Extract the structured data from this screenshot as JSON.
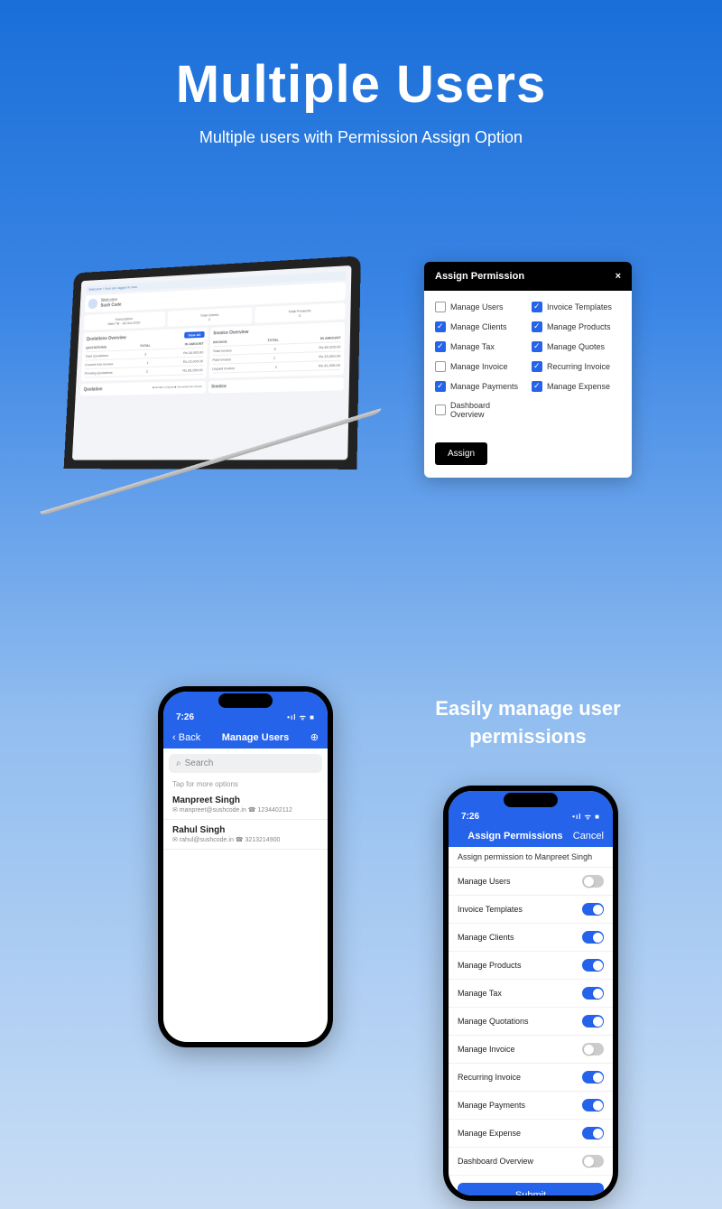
{
  "hero": {
    "title": "Multiple Users",
    "subtitle": "Multiple users with Permission Assign Option"
  },
  "subtitle2": "Easily manage user permissions",
  "laptop": {
    "banner": "Welcome ! Your are logged in now.",
    "welcome_label": "Welcome",
    "user": "Sush Code",
    "sub_label": "Subscription",
    "sub_value": "Valid Till - 18-Oct-2029",
    "clients_label": "Total Clients",
    "clients_value": "2",
    "products_label": "Total Products",
    "products_value": "3",
    "quotations_title": "Quotations Overview",
    "invoice_title": "Invoice Overview",
    "view_all": "View All",
    "q_headers": {
      "a": "QUOTATIONS",
      "b": "TOTAL",
      "c": "IN AMOUNT"
    },
    "i_headers": {
      "a": "INVOICE",
      "b": "TOTAL",
      "c": "IN AMOUNT"
    },
    "q_rows": [
      {
        "label": "Total Quotations",
        "total": "3",
        "amount": "Rs.18,005.00"
      },
      {
        "label": "Convert Into Invoice",
        "total": "1",
        "amount": "Rs.23,000.00"
      },
      {
        "label": "Pending Quotations",
        "total": "2",
        "amount": "Rs.65,255.00"
      }
    ],
    "i_rows": [
      {
        "label": "Total Invoice",
        "total": "3",
        "amount": "Rs.64,005.00"
      },
      {
        "label": "Paid Invoice",
        "total": "1",
        "amount": "Rs.23,000.00"
      },
      {
        "label": "Unpaid Invoice",
        "total": "2",
        "amount": "Rs.41,005.00"
      }
    ],
    "quotation_label": "Quotation",
    "invoice_label": "Invoice",
    "legend1": "Number of Quote",
    "legend2": "Converted into Invoice"
  },
  "perm_card": {
    "title": "Assign Permission",
    "left": [
      {
        "label": "Manage Users",
        "checked": false
      },
      {
        "label": "Manage Clients",
        "checked": true
      },
      {
        "label": "Manage Tax",
        "checked": true
      },
      {
        "label": "Manage Invoice",
        "checked": false
      },
      {
        "label": "Manage Payments",
        "checked": true
      },
      {
        "label": "Dashboard Overview",
        "checked": false
      }
    ],
    "right": [
      {
        "label": "Invoice Templates",
        "checked": true
      },
      {
        "label": "Manage Products",
        "checked": true
      },
      {
        "label": "Manage Quotes",
        "checked": true
      },
      {
        "label": "Recurring Invoice",
        "checked": true
      },
      {
        "label": "Manage Expense",
        "checked": true
      }
    ],
    "assign": "Assign"
  },
  "phone1": {
    "time": "7:26",
    "back": "Back",
    "title": "Manage Users",
    "search": "Search",
    "hint": "Tap for more options",
    "users": [
      {
        "name": "Manpreet Singh",
        "meta": "✉ manpreet@sushcode.in ☎ 1234402112"
      },
      {
        "name": "Rahul Singh",
        "meta": "✉ rahul@sushcode.in ☎ 3213214900"
      }
    ]
  },
  "phone2": {
    "time": "7:26",
    "title": "Assign Permissions",
    "cancel": "Cancel",
    "subtitle": "Assign permission to Manpreet Singh",
    "items": [
      {
        "label": "Manage Users",
        "on": false
      },
      {
        "label": "Invoice Templates",
        "on": true
      },
      {
        "label": "Manage Clients",
        "on": true
      },
      {
        "label": "Manage Products",
        "on": true
      },
      {
        "label": "Manage Tax",
        "on": true
      },
      {
        "label": "Manage Quotations",
        "on": true
      },
      {
        "label": "Manage Invoice",
        "on": false
      },
      {
        "label": "Recurring Invoice",
        "on": true
      },
      {
        "label": "Manage Payments",
        "on": true
      },
      {
        "label": "Manage Expense",
        "on": true
      },
      {
        "label": "Dashboard Overview",
        "on": false
      }
    ],
    "submit": "Submit"
  }
}
